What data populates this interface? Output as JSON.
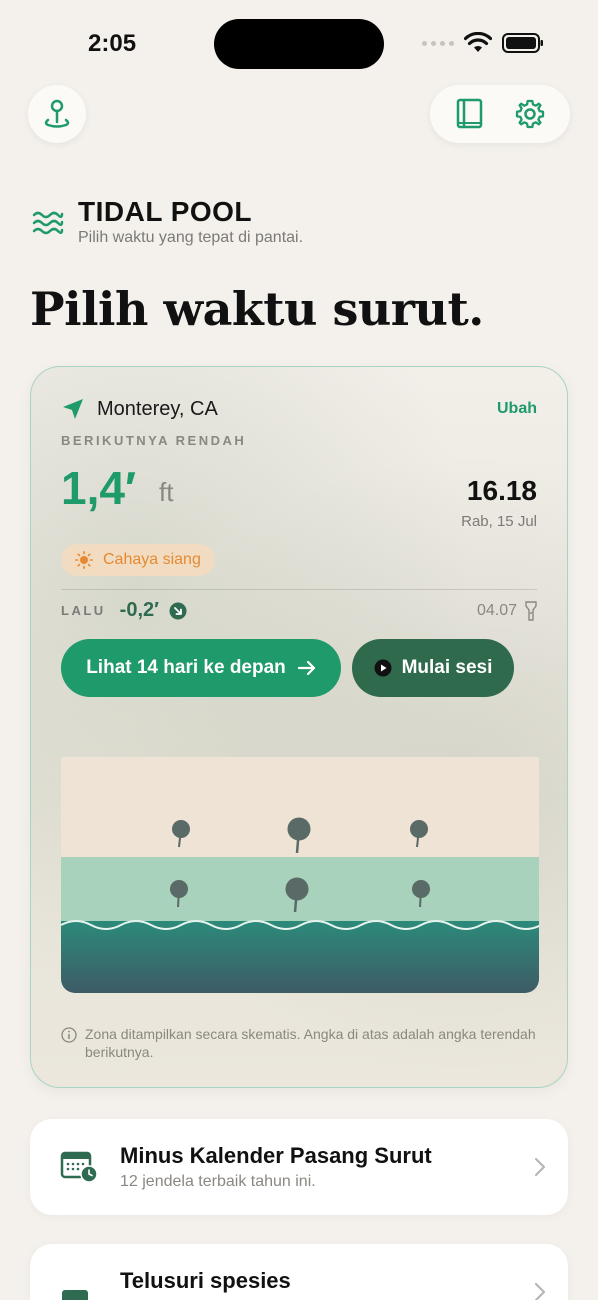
{
  "status": {
    "time": "2:05"
  },
  "brand": {
    "title": "TIDAL POOL",
    "subtitle": "Pilih waktu yang tepat di pantai."
  },
  "hero": {
    "title": "Pilih waktu surut."
  },
  "tide_card": {
    "location": "Monterey, CA",
    "change_label": "Ubah",
    "next_label": "BERIKUTNYA RENDAH",
    "next_value": "1,4′",
    "unit": "ft",
    "next_time": "16.18",
    "next_date": "Rab, 15 Jul",
    "daylight_label": "Cahaya siang",
    "prev_label": "LALU",
    "prev_value": "-0,2′",
    "prev_time": "04.07",
    "btn_next14": "Lihat 14 hari ke depan",
    "btn_session": "Mulai sesi",
    "note": "Zona ditampilkan secara skematis. Angka di atas adalah angka terendah berikutnya."
  },
  "list": [
    {
      "title": "Minus Kalender Pasang Surut",
      "subtitle": "12 jendela terbaik tahun ini."
    },
    {
      "title": "Telusuri spesies",
      "subtitle": ""
    }
  ],
  "colors": {
    "accent": "#1f9a6a",
    "accent_dark": "#2f6a4c",
    "daylight": "#e68a32"
  },
  "icons": {
    "top_left": "map-pin-icon",
    "top_right": [
      "book-icon",
      "gear-icon"
    ],
    "brand": "waves-icon",
    "location": "location-arrow-icon",
    "daylight": "sun-icon",
    "falling": "arrow-down-right-icon",
    "flashlight": "flashlight-icon",
    "play": "play-icon",
    "info": "info-icon",
    "calendar": "calendar-clock-icon",
    "chevron": "chevron-right-icon"
  }
}
